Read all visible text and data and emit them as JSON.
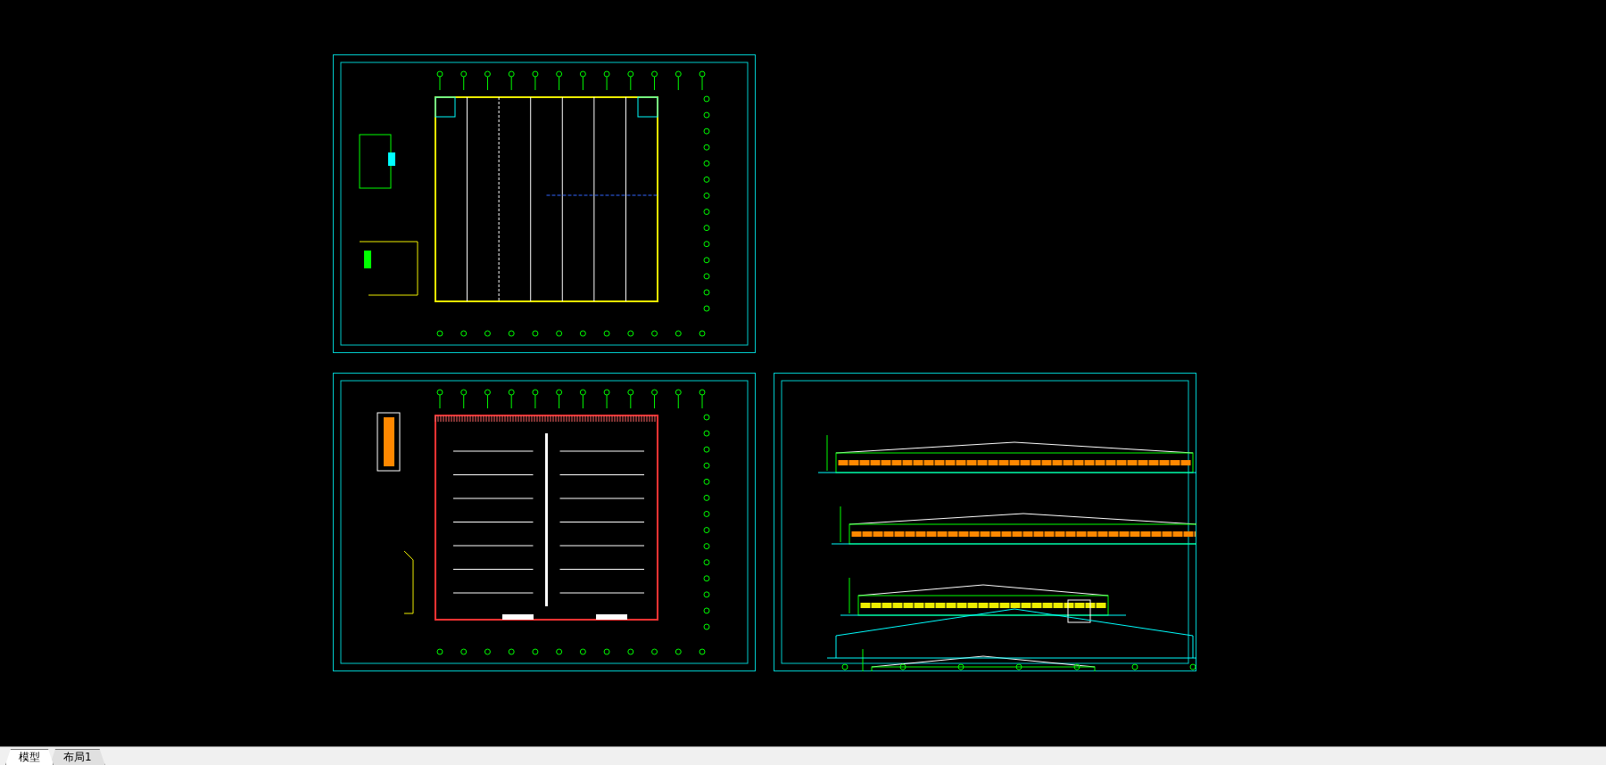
{
  "sheets": [
    {
      "kind": "floor-plan"
    },
    {
      "kind": "roof-plan"
    },
    {
      "kind": "elevations"
    }
  ],
  "tabs": [
    {
      "label": "模型",
      "selected": true
    },
    {
      "label": "布局1",
      "selected": false
    }
  ]
}
